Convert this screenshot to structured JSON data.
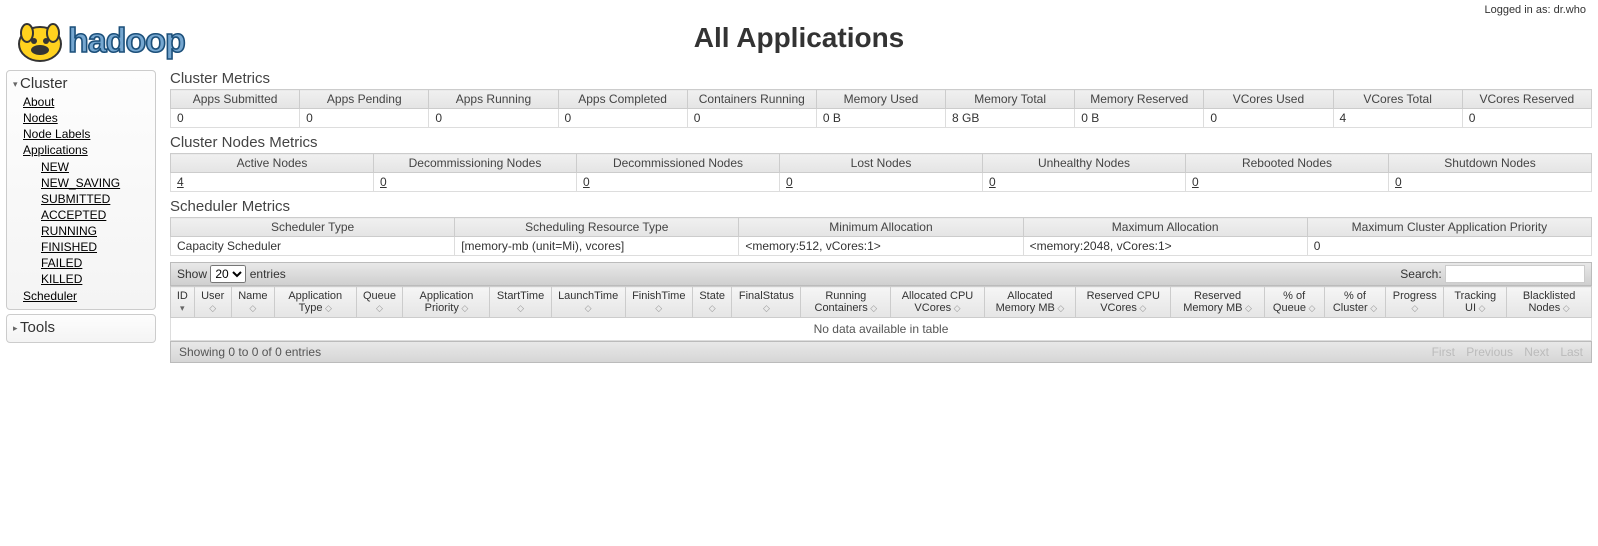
{
  "login_text": "Logged in as: dr.who",
  "page_title": "All Applications",
  "sidebar": {
    "cluster_title": "Cluster",
    "tools_title": "Tools",
    "items": [
      {
        "label": "About"
      },
      {
        "label": "Nodes"
      },
      {
        "label": "Node Labels"
      },
      {
        "label": "Applications"
      }
    ],
    "app_states": [
      {
        "label": "NEW"
      },
      {
        "label": "NEW_SAVING"
      },
      {
        "label": "SUBMITTED"
      },
      {
        "label": "ACCEPTED"
      },
      {
        "label": "RUNNING"
      },
      {
        "label": "FINISHED"
      },
      {
        "label": "FAILED"
      },
      {
        "label": "KILLED"
      }
    ],
    "scheduler": {
      "label": "Scheduler"
    }
  },
  "cluster_metrics": {
    "title": "Cluster Metrics",
    "headers": [
      "Apps Submitted",
      "Apps Pending",
      "Apps Running",
      "Apps Completed",
      "Containers Running",
      "Memory Used",
      "Memory Total",
      "Memory Reserved",
      "VCores Used",
      "VCores Total",
      "VCores Reserved"
    ],
    "values": [
      "0",
      "0",
      "0",
      "0",
      "0",
      "0 B",
      "8 GB",
      "0 B",
      "0",
      "4",
      "0"
    ]
  },
  "nodes_metrics": {
    "title": "Cluster Nodes Metrics",
    "headers": [
      "Active Nodes",
      "Decommissioning Nodes",
      "Decommissioned Nodes",
      "Lost Nodes",
      "Unhealthy Nodes",
      "Rebooted Nodes",
      "Shutdown Nodes"
    ],
    "values": [
      "4",
      "0",
      "0",
      "0",
      "0",
      "0",
      "0"
    ]
  },
  "scheduler_metrics": {
    "title": "Scheduler Metrics",
    "headers": [
      "Scheduler Type",
      "Scheduling Resource Type",
      "Minimum Allocation",
      "Maximum Allocation",
      "Maximum Cluster Application Priority"
    ],
    "values": [
      "Capacity Scheduler",
      "[memory-mb (unit=Mi), vcores]",
      "<memory:512, vCores:1>",
      "<memory:2048, vCores:1>",
      "0"
    ]
  },
  "datatable": {
    "show_label_pre": "Show",
    "show_value": "20",
    "show_label_post": "entries",
    "search_label": "Search:",
    "columns": [
      "ID",
      "User",
      "Name",
      "Application Type",
      "Queue",
      "Application Priority",
      "StartTime",
      "LaunchTime",
      "FinishTime",
      "State",
      "FinalStatus",
      "Running Containers",
      "Allocated CPU VCores",
      "Allocated Memory MB",
      "Reserved CPU VCores",
      "Reserved Memory MB",
      "% of Queue",
      "% of Cluster",
      "Progress",
      "Tracking UI",
      "Blacklisted Nodes"
    ],
    "empty": "No data available in table",
    "info": "Showing 0 to 0 of 0 entries",
    "pager": {
      "first": "First",
      "prev": "Previous",
      "next": "Next",
      "last": "Last"
    }
  }
}
